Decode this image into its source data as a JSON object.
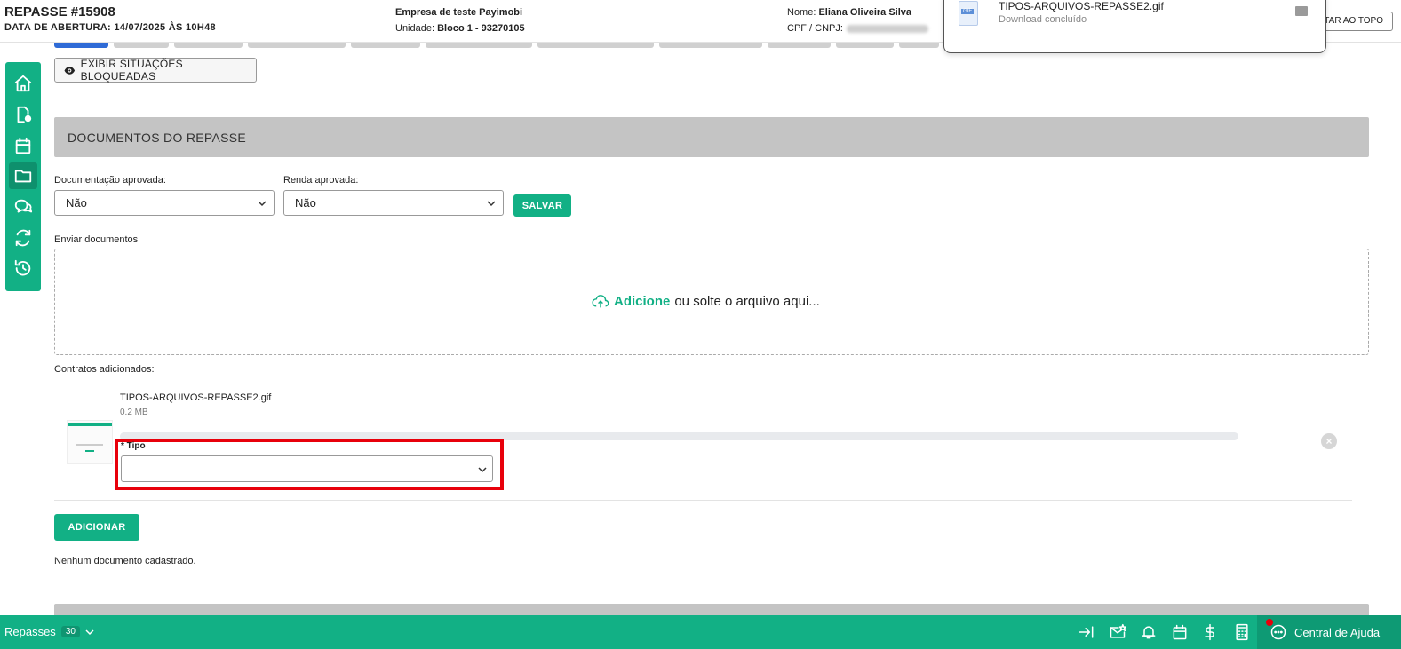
{
  "header": {
    "title": "REPASSE #15908",
    "opening_label": "DATA DE ABERTURA:",
    "opening_value": "14/07/2025 ÀS 10H48",
    "company": "Empresa de teste Payimobi",
    "unit_label": "Unidade:",
    "unit_value": "Bloco 1 - 93270105",
    "name_label": "Nome:",
    "name_value": "Eliana Oliveira Silva",
    "cpf_label": "CPF / CNPJ:",
    "back_to_top": "LTAR AO TOPO"
  },
  "download": {
    "filename": "TIPOS-ARQUIVOS-REPASSE2.gif",
    "status": "Download concluído",
    "file_tag": "GIF"
  },
  "toolbar": {
    "blocked_button": "EXIBIR SITUAÇÕES BLOQUEADAS"
  },
  "section": {
    "title": "DOCUMENTOS DO REPASSE"
  },
  "form": {
    "doc_approved_label": "Documentação aprovada:",
    "doc_approved_value": "Não",
    "income_approved_label": "Renda aprovada:",
    "income_approved_value": "Não",
    "save_label": "SALVAR",
    "send_docs_label": "Enviar documentos",
    "dropzone_add": "Adicione",
    "dropzone_rest": "ou solte o arquivo aqui..."
  },
  "contracts": {
    "label": "Contratos adicionados:",
    "file_name": "TIPOS-ARQUIVOS-REPASSE2.gif",
    "file_size": "0.2 MB",
    "tipo_label": "* Tipo",
    "tipo_value": "",
    "add_label": "ADICIONAR",
    "empty_message": "Nenhum documento cadastrado."
  },
  "bottombar": {
    "repasses_label": "Repasses",
    "repasses_count": "30",
    "help_label": "Central de Ajuda"
  },
  "colors": {
    "accent": "#12b085",
    "highlight": "#e8000b",
    "section_bg": "#c4c4c4"
  }
}
